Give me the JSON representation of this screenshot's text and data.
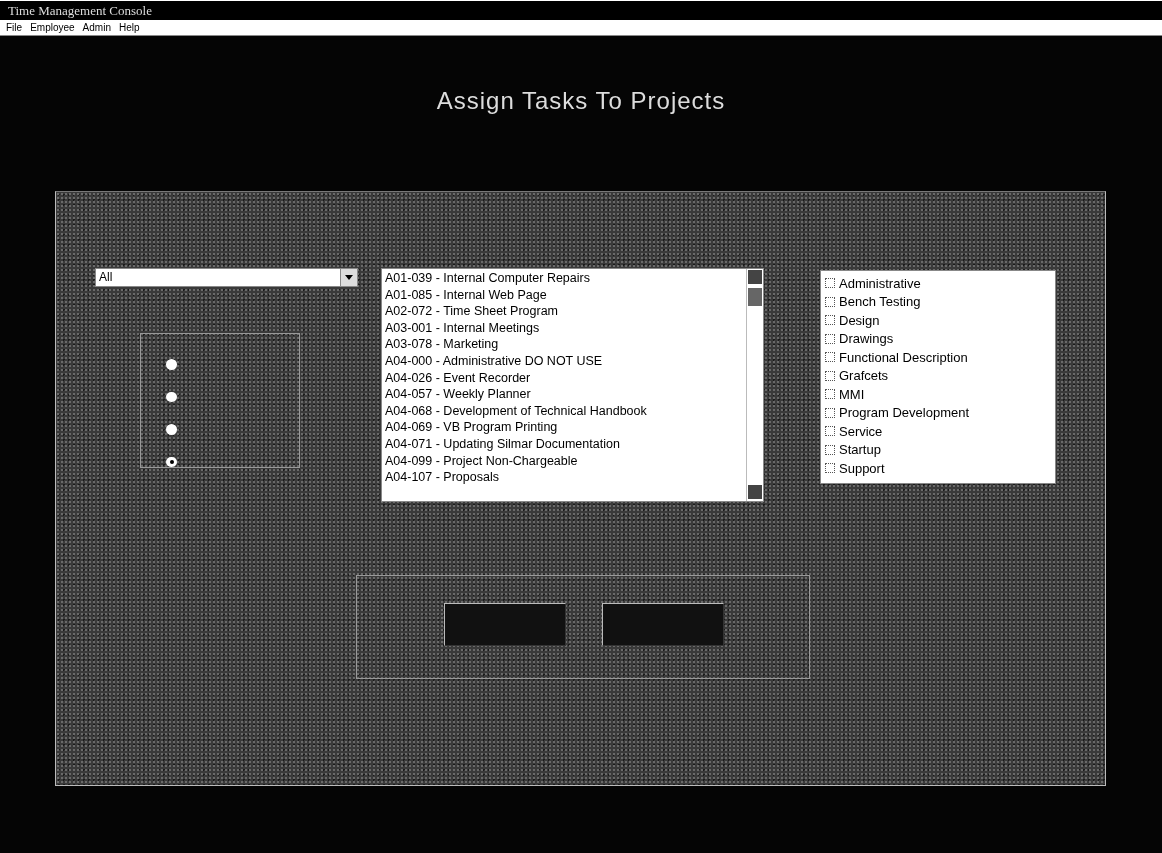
{
  "window": {
    "title": "Time Management Console"
  },
  "menu": [
    "File",
    "Employee",
    "Admin",
    "Help"
  ],
  "heading": "Assign Tasks To Projects",
  "filter": {
    "value": "All"
  },
  "options": [
    {
      "selected": false
    },
    {
      "selected": false
    },
    {
      "selected": false
    },
    {
      "selected": true
    }
  ],
  "projects": [
    "A01-039 - Internal Computer Repairs",
    "A01-085 - Internal Web Page",
    "A02-072 - Time Sheet Program",
    "A03-001 - Internal Meetings",
    "A03-078 - Marketing",
    "A04-000 - Administrative DO NOT USE",
    "A04-026 - Event Recorder",
    "A04-057 - Weekly Planner",
    "A04-068 - Development of Technical Handbook",
    "A04-069 - VB Program Printing",
    "A04-071 - Updating Silmar Documentation",
    "A04-099 - Project Non-Chargeable",
    "A04-107 - Proposals"
  ],
  "tasks": [
    {
      "label": "Administrative",
      "checked": false
    },
    {
      "label": "Bench Testing",
      "checked": false
    },
    {
      "label": "Design",
      "checked": false
    },
    {
      "label": "Drawings",
      "checked": false
    },
    {
      "label": "Functional Description",
      "checked": false
    },
    {
      "label": "Grafcets",
      "checked": false
    },
    {
      "label": "MMI",
      "checked": false
    },
    {
      "label": "Program Development",
      "checked": false
    },
    {
      "label": "Service",
      "checked": false
    },
    {
      "label": "Startup",
      "checked": false
    },
    {
      "label": "Support",
      "checked": false
    }
  ],
  "buttons": [
    {
      "kind": "push"
    },
    {
      "kind": "push"
    }
  ]
}
